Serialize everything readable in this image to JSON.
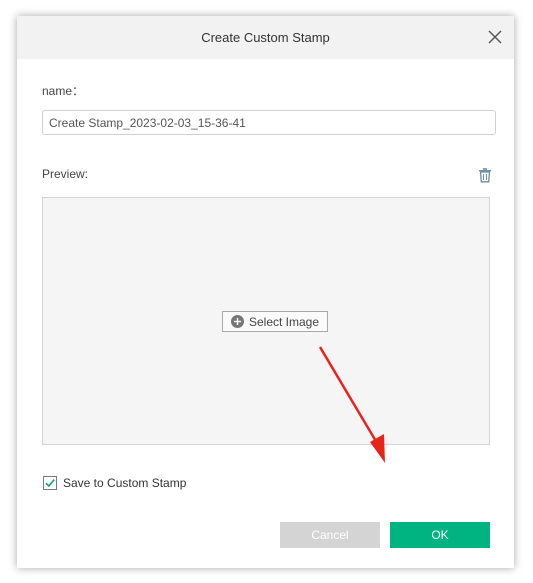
{
  "dialog": {
    "title": "Create Custom Stamp",
    "close_icon": "close-icon"
  },
  "name_field": {
    "label": "name：",
    "value": "Create Stamp_2023-02-03_15-36-41"
  },
  "preview": {
    "label": "Preview:",
    "delete_icon": "trash-icon",
    "select_image_label": "Select Image",
    "select_image_icon": "plus-circle-icon"
  },
  "save_option": {
    "label": "Save to Custom Stamp",
    "checked": true
  },
  "buttons": {
    "cancel_label": "Cancel",
    "ok_label": "OK"
  },
  "colors": {
    "ok_button": "#00b482",
    "cancel_button": "#d4d4d4",
    "annotation_arrow": "#e8231a"
  }
}
